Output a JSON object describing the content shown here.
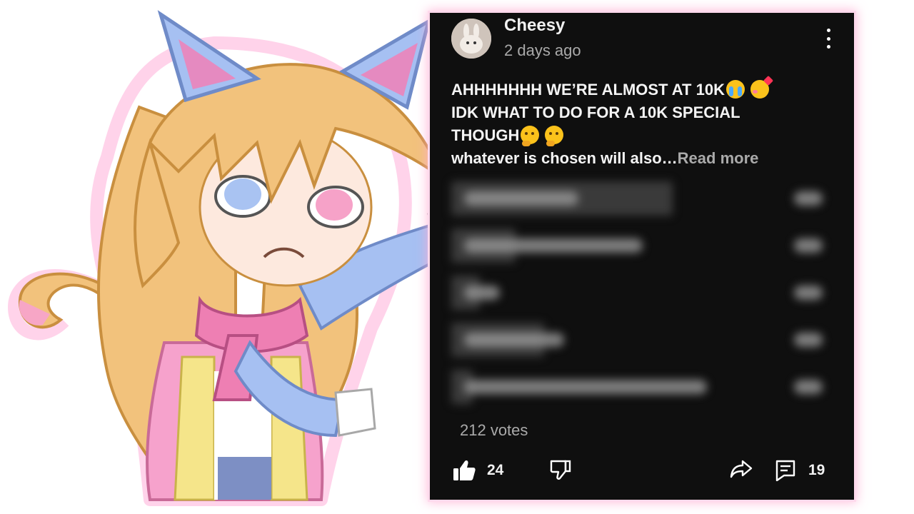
{
  "post": {
    "author": "Cheesy",
    "time": "2 days ago",
    "text_lines": [
      "AHHHHHHH WE’RE ALMOST AT 10K",
      "IDK WHAT TO DO FOR A 10K SPECIAL",
      "THOUGH",
      "whatever is chosen will also…"
    ],
    "read_more": "Read more",
    "poll": {
      "votes_label": "212 votes",
      "blurred": true,
      "option_count": 5
    },
    "actions": {
      "like_count": "24",
      "comment_count": "19"
    },
    "icons": [
      "more-vert-icon",
      "thumbs-up-icon",
      "thumbs-down-icon",
      "share-icon",
      "comment-icon"
    ]
  },
  "colors": {
    "post_background": "#0f0f0f",
    "text_primary": "#f1f1f1",
    "text_secondary": "#aaaaaa",
    "glow": "#ffb3d6"
  }
}
